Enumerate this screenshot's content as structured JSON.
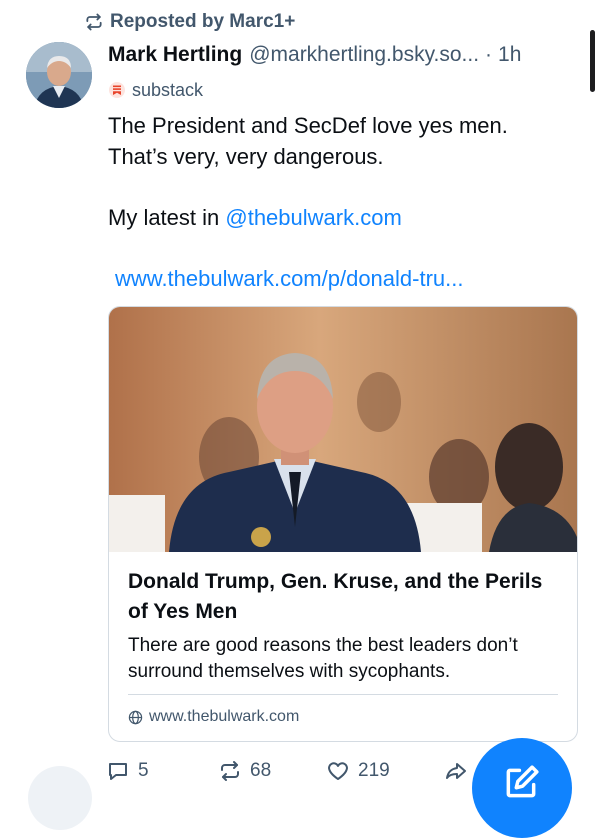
{
  "repost": {
    "text": "Reposted by Marc1+",
    "icon": "repost-icon"
  },
  "author": {
    "name": "Mark Hertling",
    "handle": "@markhertling.bsky.so...",
    "separator": "·",
    "time": "1h",
    "avatar": "avatar-photo"
  },
  "label": {
    "text": "substack",
    "icon": "substack-icon",
    "color": "#e8442b"
  },
  "post": {
    "line1": "The President and SecDef love yes men.",
    "line2": "That’s very, very dangerous.",
    "latest_prefix": "My latest in ",
    "mention": "@thebulwark.com",
    "url": "www.thebulwark.com/p/donald-tru..."
  },
  "card": {
    "image": "photo-general-at-hearing",
    "title": "Donald Trump, Gen. Kruse, and the Perils of Yes Men",
    "description": "There are good reasons the best leaders don’t surround themselves with sycophants.",
    "domain": "www.thebulwark.com",
    "domain_icon": "globe-icon"
  },
  "actions": {
    "replies": "5",
    "reposts": "68",
    "likes": "219"
  },
  "colors": {
    "link": "#1083fe",
    "muted": "#42576c",
    "fab": "#1083fe",
    "border": "#d4dbe2"
  }
}
